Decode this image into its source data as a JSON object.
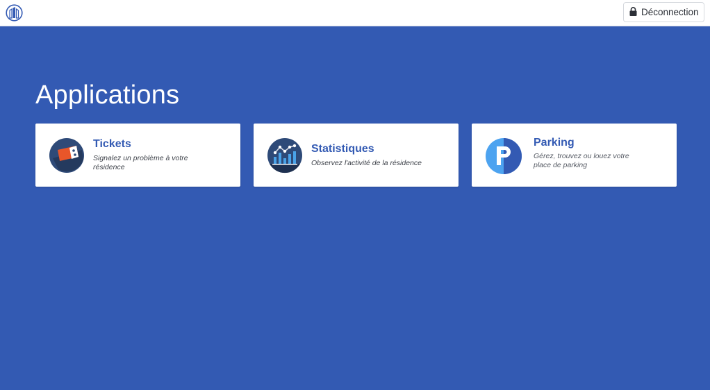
{
  "header": {
    "logo_icon": "building-logo-icon",
    "logout": {
      "icon": "lock-icon",
      "label": "Déconnection"
    }
  },
  "main": {
    "title": "Applications",
    "cards": [
      {
        "title": "Tickets",
        "description": "Signalez un problème à votre résidence",
        "icon": "ticket-icon"
      },
      {
        "title": "Statistiques",
        "description": "Observez l'activité de la résidence",
        "icon": "statistics-chart-icon"
      },
      {
        "title": "Parking",
        "description": "Gérez, trouvez ou louez votre place de parking",
        "icon": "parking-icon"
      }
    ]
  },
  "colors": {
    "background": "#335ab3",
    "accent": "#335ab3",
    "card_background": "#ffffff"
  }
}
